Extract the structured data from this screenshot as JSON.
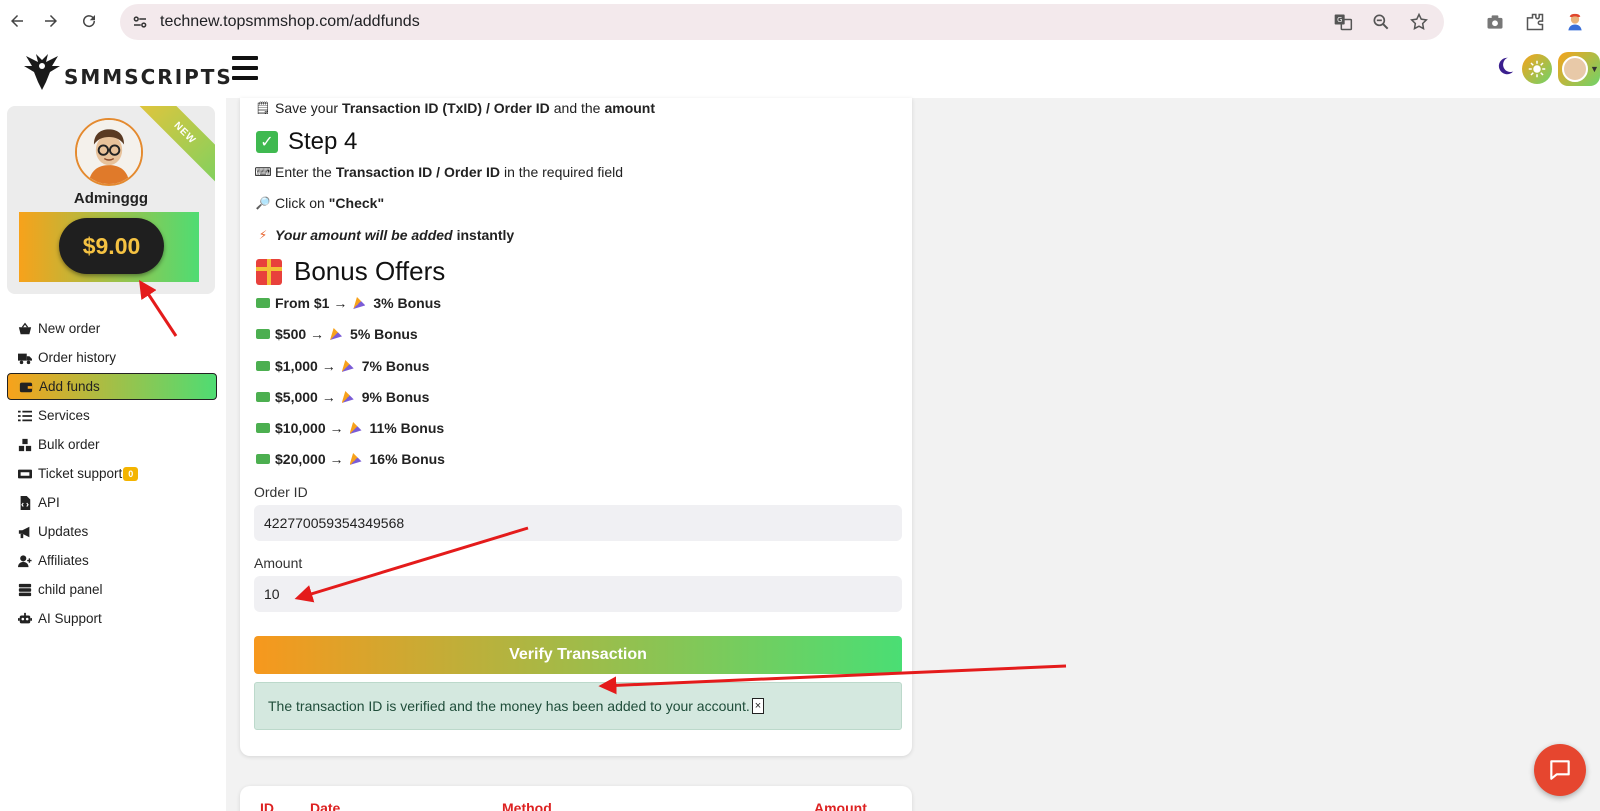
{
  "browser": {
    "url": "technew.topsmmshop.com/addfunds"
  },
  "header": {
    "logo_text": "SMMSCRIPTS"
  },
  "profile": {
    "ribbon": "NEW",
    "username": "Adminggg",
    "balance": "$9.00"
  },
  "sidebar": {
    "items": [
      {
        "label": "New order",
        "icon": "basket-icon"
      },
      {
        "label": "Order history",
        "icon": "truck-icon"
      },
      {
        "label": "Add funds",
        "icon": "wallet-icon",
        "active": true
      },
      {
        "label": "Services",
        "icon": "list-icon"
      },
      {
        "label": "Bulk order",
        "icon": "boxes-icon"
      },
      {
        "label": "Ticket support",
        "icon": "ticket-icon",
        "badge": "0"
      },
      {
        "label": "API",
        "icon": "file-code-icon"
      },
      {
        "label": "Updates",
        "icon": "megaphone-icon"
      },
      {
        "label": "Affiliates",
        "icon": "user-plus-icon"
      },
      {
        "label": "child panel",
        "icon": "server-icon"
      },
      {
        "label": "AI Support",
        "icon": "robot-icon"
      }
    ]
  },
  "instructions": {
    "save_prefix": "Save your",
    "save_bold1": "Transaction ID (TxID) / Order ID",
    "save_mid": "and the",
    "save_bold2": "amount",
    "step4_title": "Step 4",
    "enter_prefix": "Enter the",
    "enter_bold": "Transaction ID / Order ID",
    "enter_suffix": "in the required field",
    "click_prefix": "Click on",
    "click_bold": "\"Check\"",
    "instant_bold": "Your amount will be added",
    "instant_suffix": "instantly"
  },
  "bonus": {
    "title": "Bonus Offers",
    "offers": [
      {
        "from": "From $1 →",
        "bonus": "3% Bonus"
      },
      {
        "from": "$500 →",
        "bonus": "5% Bonus"
      },
      {
        "from": "$1,000 →",
        "bonus": "7% Bonus"
      },
      {
        "from": "$5,000 →",
        "bonus": "9% Bonus"
      },
      {
        "from": "$10,000 →",
        "bonus": "11% Bonus"
      },
      {
        "from": "$20,000 →",
        "bonus": "16% Bonus"
      }
    ]
  },
  "form": {
    "order_id_label": "Order ID",
    "order_id_value": "422770059354349568",
    "amount_label": "Amount",
    "amount_value": "10",
    "verify_button": "Verify Transaction",
    "success_message": "The transaction ID is verified and the money has been added to your account.",
    "close_glyph": "×"
  },
  "history_table": {
    "columns": [
      "ID",
      "Date",
      "Method",
      "Amount"
    ]
  },
  "colors": {
    "accent_orange": "#f7a21b",
    "accent_green": "#4fdc73",
    "alert_bg": "#d4e8df",
    "chat_red": "#e6462f",
    "table_header": "#dd2222"
  }
}
